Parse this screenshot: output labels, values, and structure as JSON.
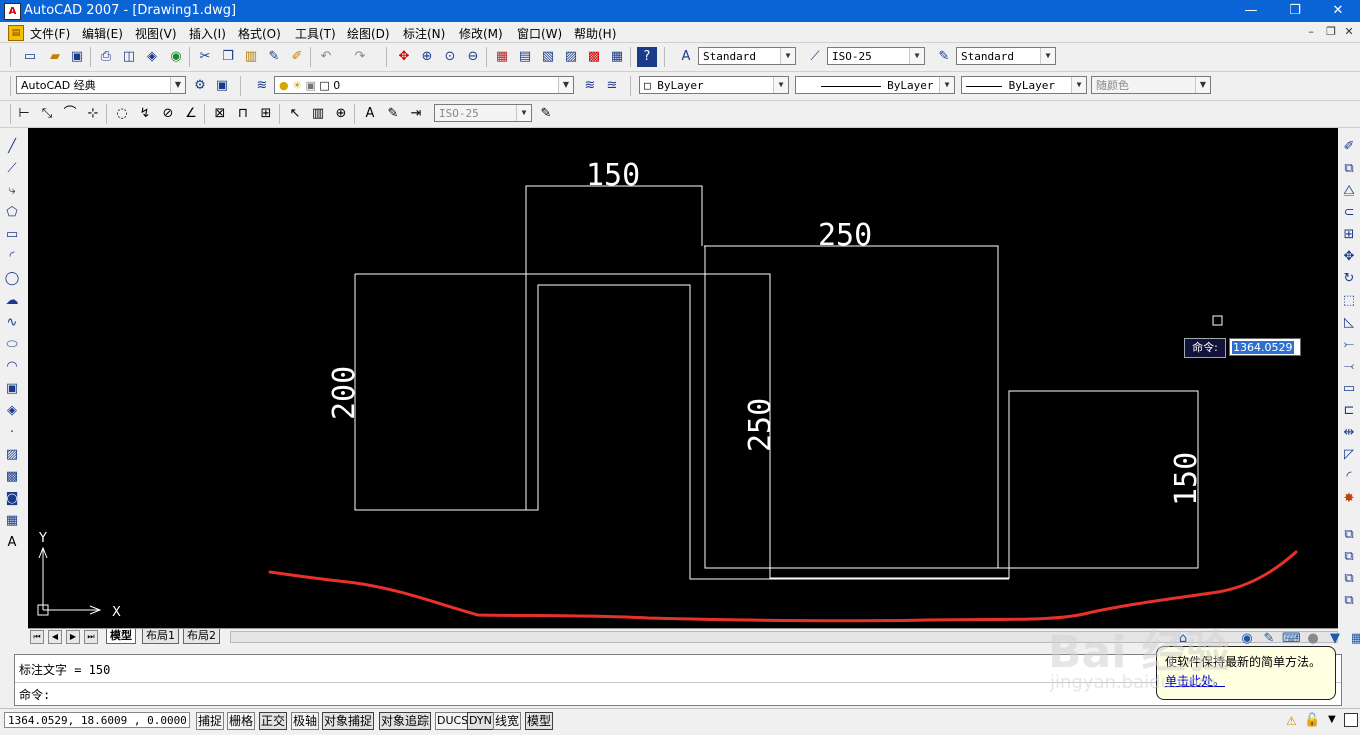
{
  "window": {
    "title": "AutoCAD 2007 - [Drawing1.dwg]",
    "app_icon": "autocad-logo-icon",
    "minimize": "—",
    "restore": "❐",
    "close": "✕"
  },
  "menubar": {
    "items": [
      "文件(F)",
      "编辑(E)",
      "视图(V)",
      "插入(I)",
      "格式(O)",
      "工具(T)",
      "绘图(D)",
      "标注(N)",
      "修改(M)",
      "窗口(W)",
      "帮助(H)"
    ],
    "doc_min": "–",
    "doc_restore": "❐",
    "doc_close": "✕"
  },
  "toolbar_styles": {
    "text_style": "Standard",
    "dim_style": "ISO-25",
    "table_style": "Standard"
  },
  "toolbar_layers": {
    "workspace": "AutoCAD 经典",
    "layer": "0",
    "color": "ByLayer",
    "linetype": "ByLayer",
    "lineweight": "ByLayer",
    "plotstyle": "随颜色"
  },
  "toolbar_dim": {
    "dim_style": "ISO-25"
  },
  "drawing": {
    "dimensions": [
      "150",
      "250",
      "200",
      "250",
      "150"
    ],
    "ucs_x": "X",
    "ucs_y": "Y",
    "annotation_color": "#e8312b",
    "line_color": "#ffffff"
  },
  "dynamic_input": {
    "label": "命令:",
    "value": "1364.0529"
  },
  "tabs": {
    "items": [
      "模型",
      "布局1",
      "布局2"
    ],
    "active": "模型"
  },
  "command": {
    "history": "标注文字 = 150",
    "prompt": "命令:"
  },
  "status": {
    "coords": "1364.0529, 18.6009 , 0.0000",
    "buttons": [
      "捕捉",
      "栅格",
      "正交",
      "极轴",
      "对象捕捉",
      "对象追踪",
      "DUCS",
      "DYN",
      "线宽",
      "模型"
    ]
  },
  "balloon": {
    "text": "使软件保持最新的简单方法。",
    "link": "单击此处。"
  },
  "watermark": {
    "brand": "Bai 经验",
    "url": "jingyan.baidu.com"
  }
}
